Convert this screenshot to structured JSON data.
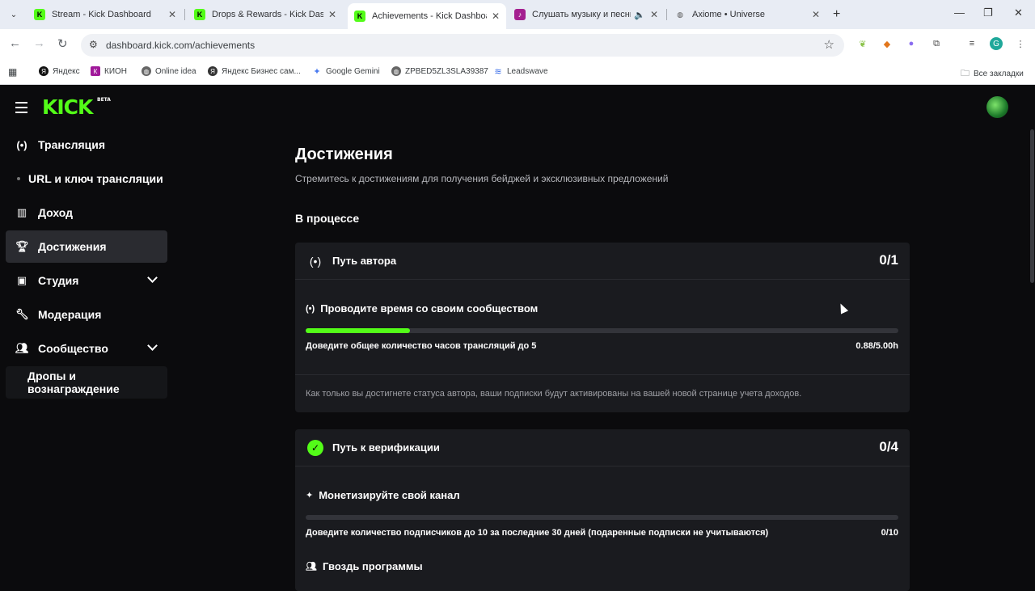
{
  "browser": {
    "tabs": [
      {
        "label": "Stream - Kick Dashboard",
        "fav_color": "#53fc18",
        "fav_text": "K"
      },
      {
        "label": "Drops & Rewards - Kick Dashbo",
        "fav_color": "#53fc18",
        "fav_text": "K"
      },
      {
        "label": "Achievements - Kick Dashboard",
        "fav_color": "#53fc18",
        "fav_text": "K"
      },
      {
        "label": "Слушать музыку и песни о",
        "fav_color": "#a42090",
        "fav_text": "♪"
      },
      {
        "label": "Axiome • Universe",
        "fav_color": "#ffffff",
        "fav_text": "◍"
      }
    ],
    "active_tab_index": 2,
    "url": "dashboard.kick.com/achievements",
    "bookmarks": [
      {
        "label": "Яндекс",
        "icon": "yandex-icon"
      },
      {
        "label": "КИОН",
        "icon": "kion-icon"
      },
      {
        "label": "Online idea",
        "icon": "globe-icon"
      },
      {
        "label": "Яндекс Бизнес сам...",
        "icon": "yandex-business-icon"
      },
      {
        "label": "Google Gemini",
        "icon": "gemini-icon"
      },
      {
        "label": "ZPBED5ZL3SLA39387",
        "icon": "globe-icon"
      },
      {
        "label": "Leadswave",
        "icon": "leadswave-icon"
      }
    ],
    "all_bookmarks_label": "Все закладки",
    "profile_initial": "G"
  },
  "app": {
    "logo_text": "KICK",
    "logo_badge": "BETA",
    "accent_color": "#53fc18",
    "sidebar": {
      "items": [
        {
          "label": "Трансляция",
          "icon": "broadcast-icon"
        },
        {
          "label": "URL и ключ трансляции",
          "icon": "dot-icon"
        },
        {
          "label": "Доход",
          "icon": "chart-icon"
        },
        {
          "label": "Достижения",
          "icon": "trophy-icon"
        },
        {
          "label": "Студия",
          "icon": "studio-icon"
        },
        {
          "label": "Модерация",
          "icon": "wrench-icon"
        },
        {
          "label": "Сообщество",
          "icon": "community-icon"
        },
        {
          "label": "Дропы и вознаграждение",
          "icon": ""
        }
      ],
      "active_index": 3
    },
    "page": {
      "title": "Достижения",
      "subtitle": "Стремитесь к достижениям для получения бейджей и эксклюзивных предложений",
      "section_title": "В процессе",
      "cards": [
        {
          "title": "Путь автора",
          "count": "0/1",
          "task": "Проводите время со своим сообществом",
          "progress_fraction": 0.176,
          "requirement": "Доведите общее количество часов трансляций до 5",
          "value": "0.88/5.00h",
          "note": "Как только вы достигнете статуса автора, ваши подписки будут активированы на вашей новой странице учета доходов."
        },
        {
          "title": "Путь к верификации",
          "count": "0/4",
          "task": "Монетизируйте свой канал",
          "progress_fraction": 0,
          "requirement": "Доведите количество подписчиков до 10 за последние 30 дней (подаренные подписки не учитываются)",
          "value": "0/10",
          "task2": "Гвоздь программы"
        }
      ]
    }
  }
}
